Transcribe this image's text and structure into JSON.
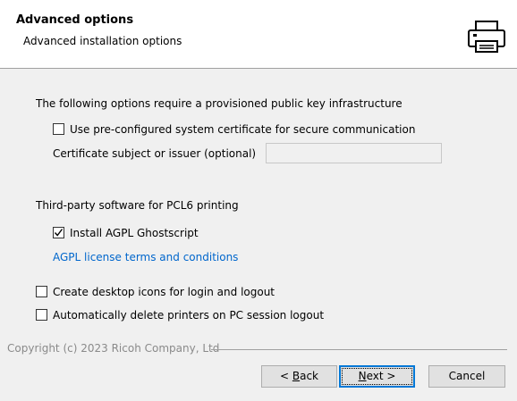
{
  "header": {
    "title": "Advanced options",
    "subtitle": "Advanced installation options",
    "icon": "printer-icon"
  },
  "pki": {
    "heading": "The following options require a provisioned public key infrastructure",
    "use_certificate": {
      "label": "Use pre-configured system certificate for secure communication",
      "checked": false
    },
    "cert_subject": {
      "label": "Certificate subject or issuer (optional)",
      "value": ""
    }
  },
  "pcl6": {
    "heading": "Third-party software for PCL6 printing",
    "install_ghostscript": {
      "label": "Install AGPL Ghostscript",
      "checked": true
    },
    "license_link": "AGPL license terms and conditions"
  },
  "options": {
    "desktop_icons": {
      "label": "Create desktop icons for login and logout",
      "checked": false
    },
    "auto_delete": {
      "label": "Automatically delete printers on PC session logout",
      "checked": false
    }
  },
  "footer": {
    "copyright": "Copyright (c) 2023 Ricoh Company, Ltd",
    "back": {
      "prefix": "< ",
      "accel": "B",
      "rest": "ack"
    },
    "next": {
      "accel": "N",
      "rest": "ext",
      "suffix": " >"
    },
    "cancel": "Cancel"
  },
  "colors": {
    "link": "#0066cc",
    "focus": "#0078d7",
    "window": "#f0f0f0"
  }
}
